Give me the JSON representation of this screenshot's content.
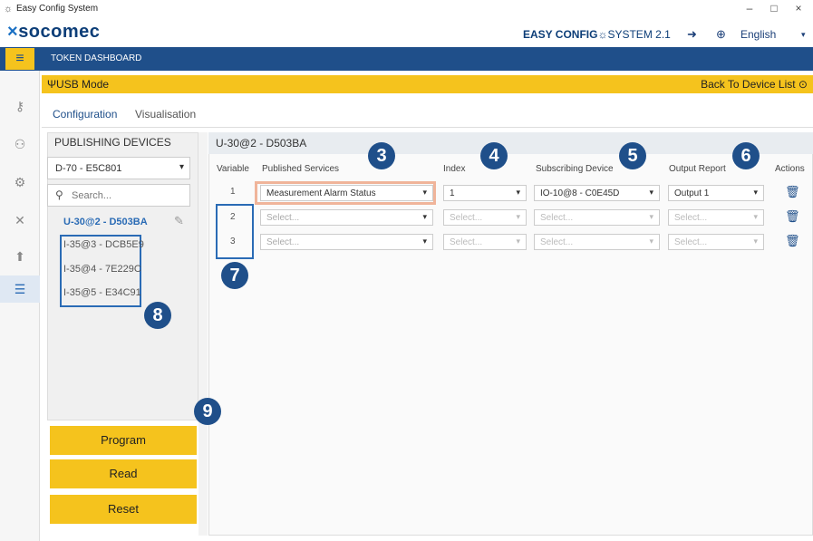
{
  "window": {
    "title": "Easy Config System",
    "minimize": "–",
    "maximize": "□",
    "close": "×"
  },
  "brand": {
    "logo_mark": "×",
    "logo_text": "socomec",
    "product_bold": "EASY CONFIG",
    "product_mark": "☼",
    "product_rest": "SYSTEM 2.1",
    "language": "English",
    "lang_chevron": "▾",
    "logout_icon": "logout-icon",
    "globe_icon": "globe-icon"
  },
  "nav": {
    "menu_icon": "≡",
    "title": "TOKEN DASHBOARD"
  },
  "usb_bar": {
    "mode_label": "USB Mode",
    "usb_icon": "Ψ",
    "back_label": "Back To Device List ⊙"
  },
  "rail": {
    "icons": [
      "⚷",
      "⚇",
      "⚙",
      "✕",
      "⬆",
      "☰"
    ]
  },
  "tabs": {
    "configuration": "Configuration",
    "visualisation": "Visualisation"
  },
  "publishing": {
    "header": "PUBLISHING DEVICES",
    "selected_device": "D-70 - E5C801",
    "search_placeholder": "Search...",
    "active_device": "U-30@2 - D503BA",
    "devices": [
      "I-35@3 - DCB5E9",
      "I-35@4 - 7E229C",
      "I-35@5 - E34C91"
    ]
  },
  "buttons": {
    "program": "Program",
    "read": "Read",
    "reset": "Reset"
  },
  "main": {
    "header": "U-30@2 - D503BA",
    "columns": {
      "variable": "Variable",
      "published": "Published Services",
      "index": "Index",
      "subscribing": "Subscribing Device",
      "output": "Output Report",
      "actions": "Actions"
    },
    "rows": [
      {
        "variable": "1",
        "published": "Measurement Alarm Status",
        "index": "1",
        "subscribing": "IO-10@8 - C0E45D",
        "output": "Output 1"
      },
      {
        "variable": "2",
        "published": "Select...",
        "index": "Select...",
        "subscribing": "Select...",
        "output": "Select..."
      },
      {
        "variable": "3",
        "published": "Select...",
        "index": "Select...",
        "subscribing": "Select...",
        "output": "Select..."
      }
    ]
  },
  "badges": {
    "b3": "3",
    "b4": "4",
    "b5": "5",
    "b6": "6",
    "b7": "7",
    "b8": "8",
    "b9": "9"
  },
  "colors": {
    "brand_blue": "#1f4f8a",
    "accent_yellow": "#f5c31d",
    "highlight_blue": "#2a6bb5",
    "highlight_salmon": "#f0b49a"
  }
}
